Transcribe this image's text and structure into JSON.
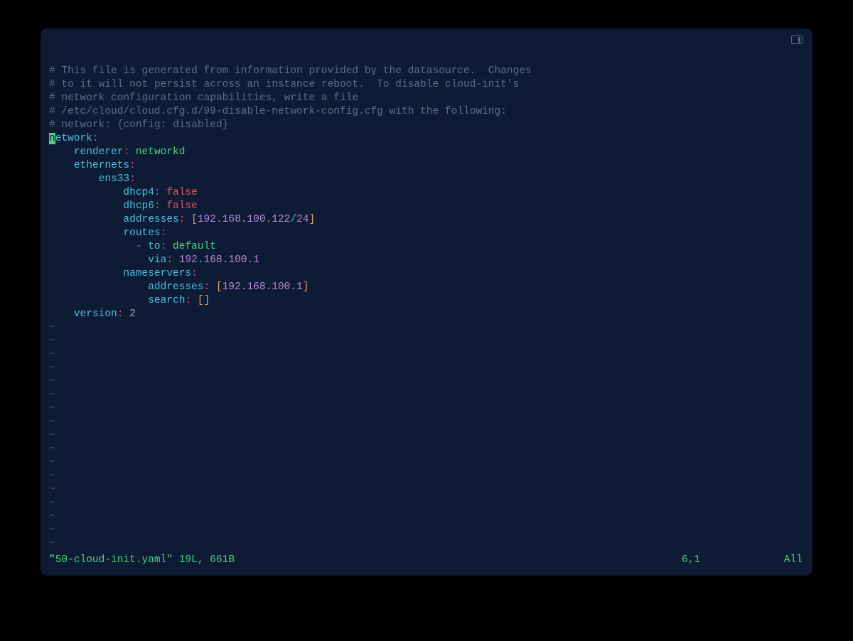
{
  "comments": {
    "c1": "# This file is generated from information provided by the datasource.  Changes",
    "c2": "# to it will not persist across an instance reboot.  To disable cloud-init's",
    "c3": "# network configuration capabilities, write a file",
    "c4": "# /etc/cloud/cloud.cfg.d/99-disable-network-config.cfg with the following:",
    "c5": "# network: {config: disabled}"
  },
  "yaml": {
    "network": "etwork",
    "cursor_char": "n",
    "renderer_key": "renderer",
    "renderer_val": "networkd",
    "ethernets_key": "ethernets",
    "iface": "ens33",
    "dhcp4_key": "dhcp4",
    "dhcp4_val": "false",
    "dhcp6_key": "dhcp6",
    "dhcp6_val": "false",
    "addresses_key": "addresses",
    "addr_ip": "192.168.100.122",
    "addr_slash": "/",
    "addr_mask": "24",
    "routes_key": "routes",
    "to_key": "to",
    "to_val": "default",
    "via_key": "via",
    "via_val": "192.168.100.1",
    "nameservers_key": "nameservers",
    "ns_addr_key": "addresses",
    "ns_addr_val": "192.168.100.1",
    "search_key": "search",
    "version_key": "version",
    "version_val": "2"
  },
  "tilde": "~",
  "status": {
    "file": "\"50-cloud-init.yaml\" 19L, 661B",
    "position": "6,1",
    "percent": "All"
  }
}
